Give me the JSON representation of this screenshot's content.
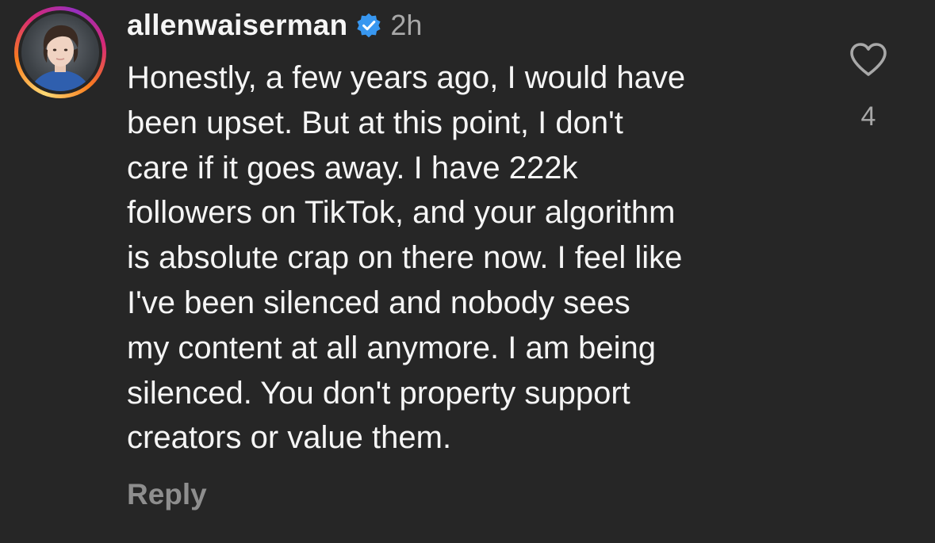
{
  "comment": {
    "username": "allenwaiserman",
    "verified_icon": "verified-badge-icon",
    "timestamp": "2h",
    "text_lines": [
      "Honestly, a few years ago, I would have",
      "been upset. But at this point, I don't",
      "care if it goes away. I have 222k",
      "followers on TikTok, and your algorithm",
      "is absolute crap on there now. I feel like",
      "I've been silenced and nobody sees",
      "my content at all anymore. I am being",
      "silenced. You don't property support",
      "creators or value them."
    ],
    "reply_label": "Reply",
    "like_icon": "heart-outline-icon",
    "like_count": "4"
  },
  "colors": {
    "background": "#262626",
    "primary_text": "#f5f5f5",
    "secondary_text": "#a8a8a8",
    "reply_text": "#8e8e8e",
    "verified_blue": "#3897f0"
  }
}
